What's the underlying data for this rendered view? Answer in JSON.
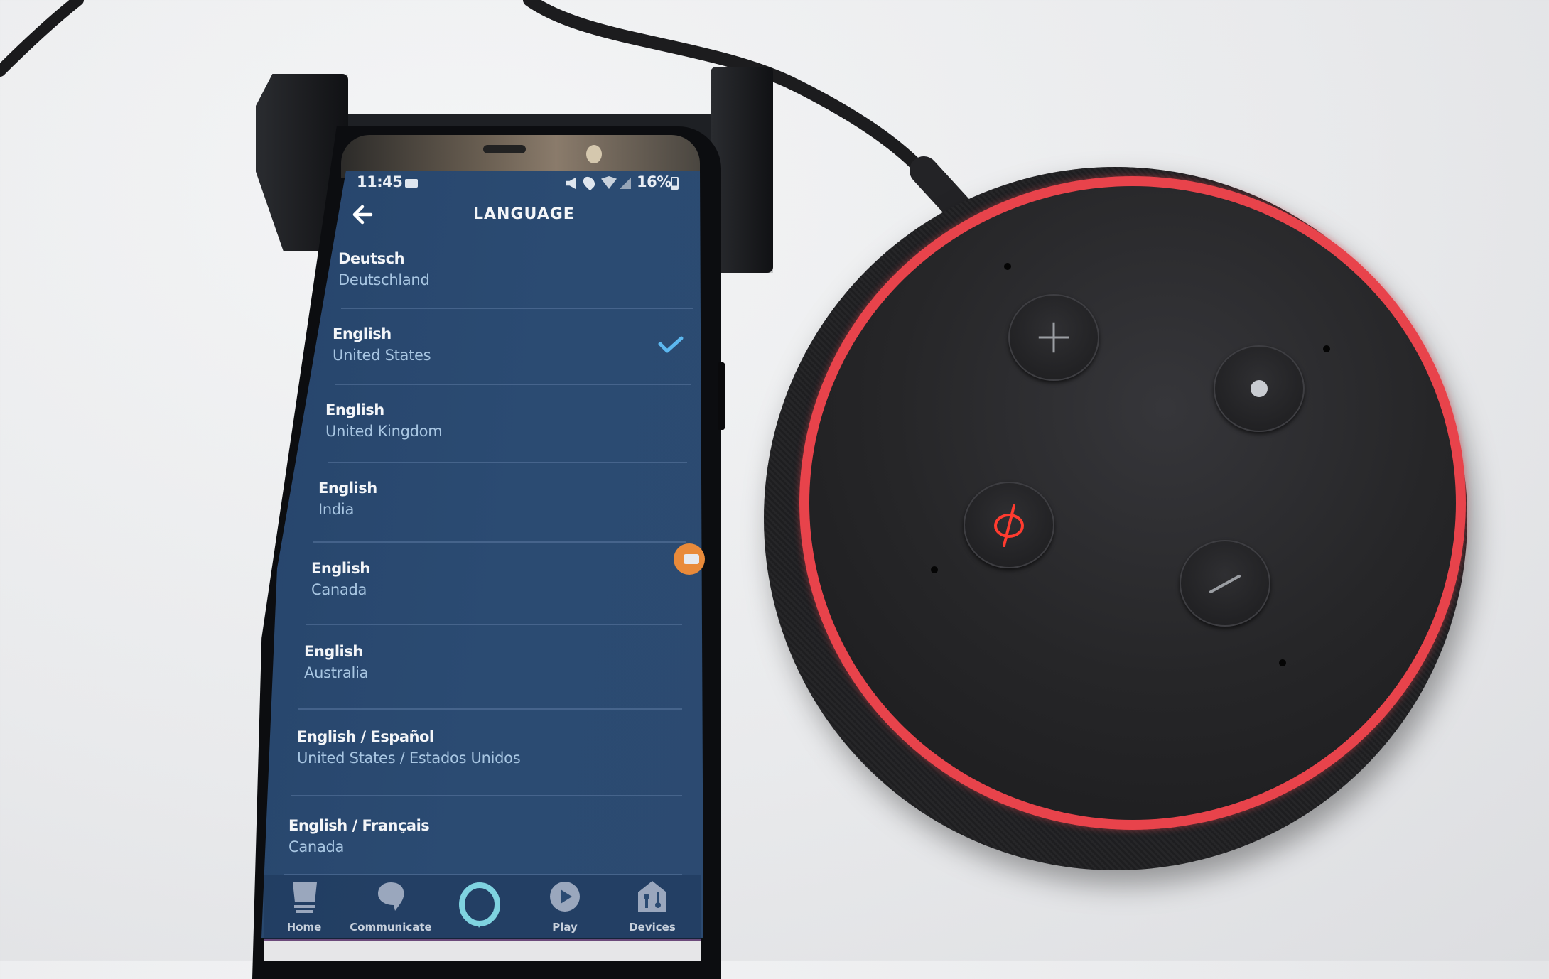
{
  "scene": {
    "description": "Phone showing Alexa app language settings next to an Echo Dot with red ring"
  },
  "phone": {
    "status_bar": {
      "time": "11:45",
      "battery": "16%",
      "icons": [
        "message-icon",
        "mute-icon",
        "location-icon",
        "wifi-icon",
        "signal-icon",
        "battery-icon"
      ]
    },
    "header": {
      "title": "LANGUAGE",
      "back_icon": "arrow-left-icon"
    },
    "languages": [
      {
        "language": "Deutsch",
        "region": "Deutschland",
        "selected": false
      },
      {
        "language": "English",
        "region": "United States",
        "selected": true
      },
      {
        "language": "English",
        "region": "United Kingdom",
        "selected": false
      },
      {
        "language": "English",
        "region": "India",
        "selected": false
      },
      {
        "language": "English",
        "region": "Canada",
        "selected": false
      },
      {
        "language": "English",
        "region": "Australia",
        "selected": false
      },
      {
        "language": "English / Español",
        "region": "United States / Estados Unidos",
        "selected": false
      },
      {
        "language": "English / Français",
        "region": "Canada",
        "selected": false
      }
    ],
    "floating_bubble_icon": "video-icon",
    "bottom_nav": [
      {
        "label": "Home",
        "icon": "home-icon"
      },
      {
        "label": "Communicate",
        "icon": "chat-bubble-icon"
      },
      {
        "label": "",
        "icon": "alexa-icon"
      },
      {
        "label": "Play",
        "icon": "play-icon"
      },
      {
        "label": "Devices",
        "icon": "devices-icon"
      }
    ]
  },
  "echo_dot": {
    "ring_color": "#e8434b",
    "ring_state": "red (microphone off)",
    "buttons": [
      {
        "name": "volume-up",
        "icon": "plus-icon"
      },
      {
        "name": "action",
        "icon": "dot-icon"
      },
      {
        "name": "microphone-off",
        "icon": "mic-off-icon",
        "active_color": "#ff3b2f"
      },
      {
        "name": "volume-down",
        "icon": "minus-icon"
      }
    ]
  },
  "colors": {
    "screen_bg": "#2b4b72",
    "check_color": "#5cb8f0",
    "region_text": "#a8c6e2",
    "alexa_ring": "#7fd3e0",
    "bubble_orange": "#e98a3a"
  }
}
